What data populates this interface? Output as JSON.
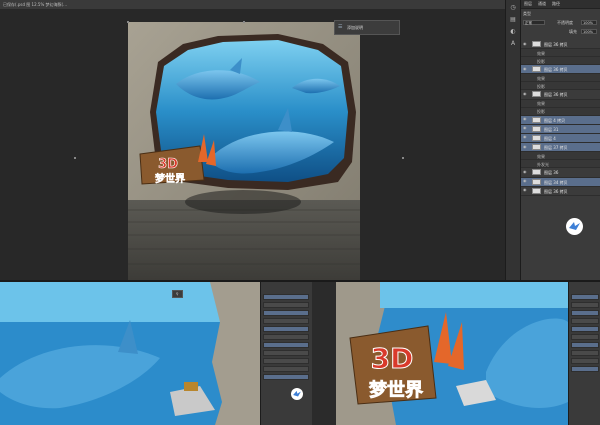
{
  "window": {
    "doc_tab": "已保存(.psd 图 12.5% 梦幻海豚(…"
  },
  "hint": {
    "label": "添加说明"
  },
  "panel": {
    "tabs": [
      "图层",
      "通道",
      "路径"
    ],
    "filter_label": "类型",
    "blend_mode": "正常",
    "opacity_label": "不透明度",
    "opacity_value": "100%",
    "fill_label": "填充",
    "fill_value": "100%"
  },
  "layers": [
    {
      "name": "图层 36 拷贝",
      "selected": false,
      "kind": "layer"
    },
    {
      "name": "效果",
      "selected": false,
      "kind": "sub"
    },
    {
      "name": "投影",
      "selected": false,
      "kind": "sub"
    },
    {
      "name": "图层 36 拷贝",
      "selected": true,
      "kind": "layer"
    },
    {
      "name": "效果",
      "selected": false,
      "kind": "sub"
    },
    {
      "name": "投影",
      "selected": false,
      "kind": "sub"
    },
    {
      "name": "图层 36 拷贝",
      "selected": false,
      "kind": "layer"
    },
    {
      "name": "效果",
      "selected": false,
      "kind": "sub"
    },
    {
      "name": "投影",
      "selected": false,
      "kind": "sub"
    },
    {
      "name": "图层 4 拷贝",
      "selected": true,
      "kind": "layer"
    },
    {
      "name": "图层 31",
      "selected": true,
      "kind": "layer"
    },
    {
      "name": "图层 4",
      "selected": true,
      "kind": "layer"
    },
    {
      "name": "图层 37 拷贝",
      "selected": true,
      "kind": "layer"
    },
    {
      "name": "效果",
      "selected": false,
      "kind": "sub"
    },
    {
      "name": "外发光",
      "selected": false,
      "kind": "sub"
    },
    {
      "name": "图层 36",
      "selected": false,
      "kind": "layer"
    },
    {
      "name": "图层 34 拷贝",
      "selected": true,
      "kind": "layer"
    },
    {
      "name": "图层 36 拷贝",
      "selected": false,
      "kind": "layer"
    }
  ],
  "artwork": {
    "sign_top": "3D",
    "sign_bottom": "梦世界"
  },
  "colors": {
    "selection": "#5a6e8c",
    "accent": "#3d7fd6"
  },
  "icons": [
    "eye-icon",
    "comment-icon",
    "bird-logo-icon"
  ]
}
